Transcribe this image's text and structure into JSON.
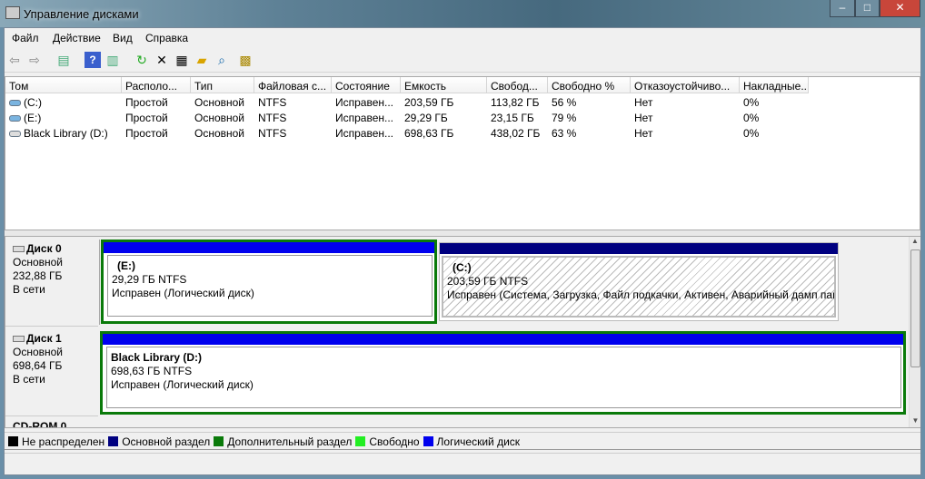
{
  "window": {
    "title": "Управление дисками",
    "minimize": "–",
    "maximize": "□",
    "close": "✕"
  },
  "menu": [
    "Файл",
    "Действие",
    "Вид",
    "Справка"
  ],
  "toolbar": [
    "back-icon",
    "forward-icon",
    "console-tree-icon",
    "help-icon",
    "action-pane-icon",
    "refresh-icon",
    "delete-icon",
    "properties-icon",
    "open-icon",
    "explore-icon",
    "settings-icon"
  ],
  "table": {
    "columns": [
      "Том",
      "Располо...",
      "Тип",
      "Файловая с...",
      "Состояние",
      "Емкость",
      "Свобод...",
      "Свободно %",
      "Отказоустойчиво...",
      "Накладные..."
    ],
    "rows": [
      [
        "(C:)",
        "Простой",
        "Основной",
        "NTFS",
        "Исправен...",
        "203,59 ГБ",
        "113,82 ГБ",
        "56 %",
        "Нет",
        "0%"
      ],
      [
        "(E:)",
        "Простой",
        "Основной",
        "NTFS",
        "Исправен...",
        "29,29 ГБ",
        "23,15 ГБ",
        "79 %",
        "Нет",
        "0%"
      ],
      [
        "Black Library (D:)",
        "Простой",
        "Основной",
        "NTFS",
        "Исправен...",
        "698,63 ГБ",
        "438,02 ГБ",
        "63 %",
        "Нет",
        "0%"
      ]
    ]
  },
  "disks": [
    {
      "name": "Диск 0",
      "type": "Основной",
      "size": "232,88 ГБ",
      "status": "В сети",
      "partitions": [
        {
          "label": "(E:)",
          "size": "29,29 ГБ NTFS",
          "status": "Исправен (Логический диск)"
        },
        {
          "label": "(C:)",
          "size": "203,59 ГБ NTFS",
          "status": "Исправен (Система, Загрузка, Файл подкачки, Активен, Аварийный дамп памяти, Основной раздел)"
        }
      ]
    },
    {
      "name": "Диск 1",
      "type": "Основной",
      "size": "698,64 ГБ",
      "status": "В сети",
      "partitions": [
        {
          "label": "Black Library  (D:)",
          "size": "698,63 ГБ NTFS",
          "status": "Исправен (Логический диск)"
        }
      ]
    },
    {
      "name": "CD-ROM 0"
    }
  ],
  "legend": [
    {
      "label": "Не распределен",
      "color": "#000000"
    },
    {
      "label": "Основной раздел",
      "color": "#000080"
    },
    {
      "label": "Дополнительный раздел",
      "color": "#0a7a0a"
    },
    {
      "label": "Свободно",
      "color": "#22ee22"
    },
    {
      "label": "Логический диск",
      "color": "#0000ee"
    }
  ]
}
